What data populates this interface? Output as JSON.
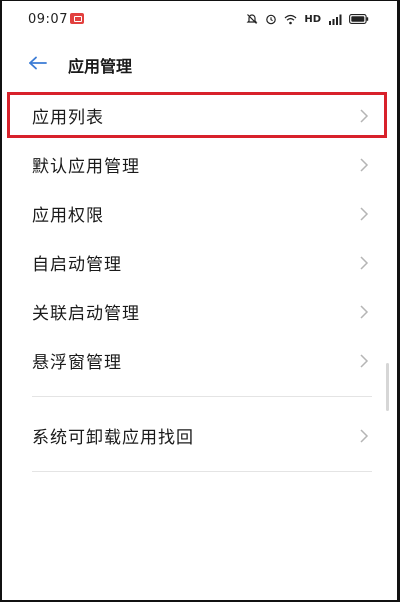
{
  "status_bar": {
    "time": "09:07",
    "hd": "HD",
    "icons": [
      "notification-badge-icon",
      "bell-mute-icon",
      "alarm-icon",
      "wifi-icon",
      "signal-icon",
      "battery-icon"
    ]
  },
  "header": {
    "back_icon": "arrow-left-icon",
    "title": "应用管理"
  },
  "menu": {
    "items": [
      {
        "label": "应用列表",
        "highlighted": true
      },
      {
        "label": "默认应用管理"
      },
      {
        "label": "应用权限"
      },
      {
        "label": "自启动管理"
      },
      {
        "label": "关联启动管理"
      },
      {
        "label": "悬浮窗管理"
      }
    ],
    "extra_items": [
      {
        "label": "系统可卸载应用找回"
      }
    ]
  },
  "colors": {
    "accent": "#3a7bd5",
    "highlight": "#d8212b",
    "text": "#1a1a1a",
    "chevron": "#b5b5b5"
  }
}
